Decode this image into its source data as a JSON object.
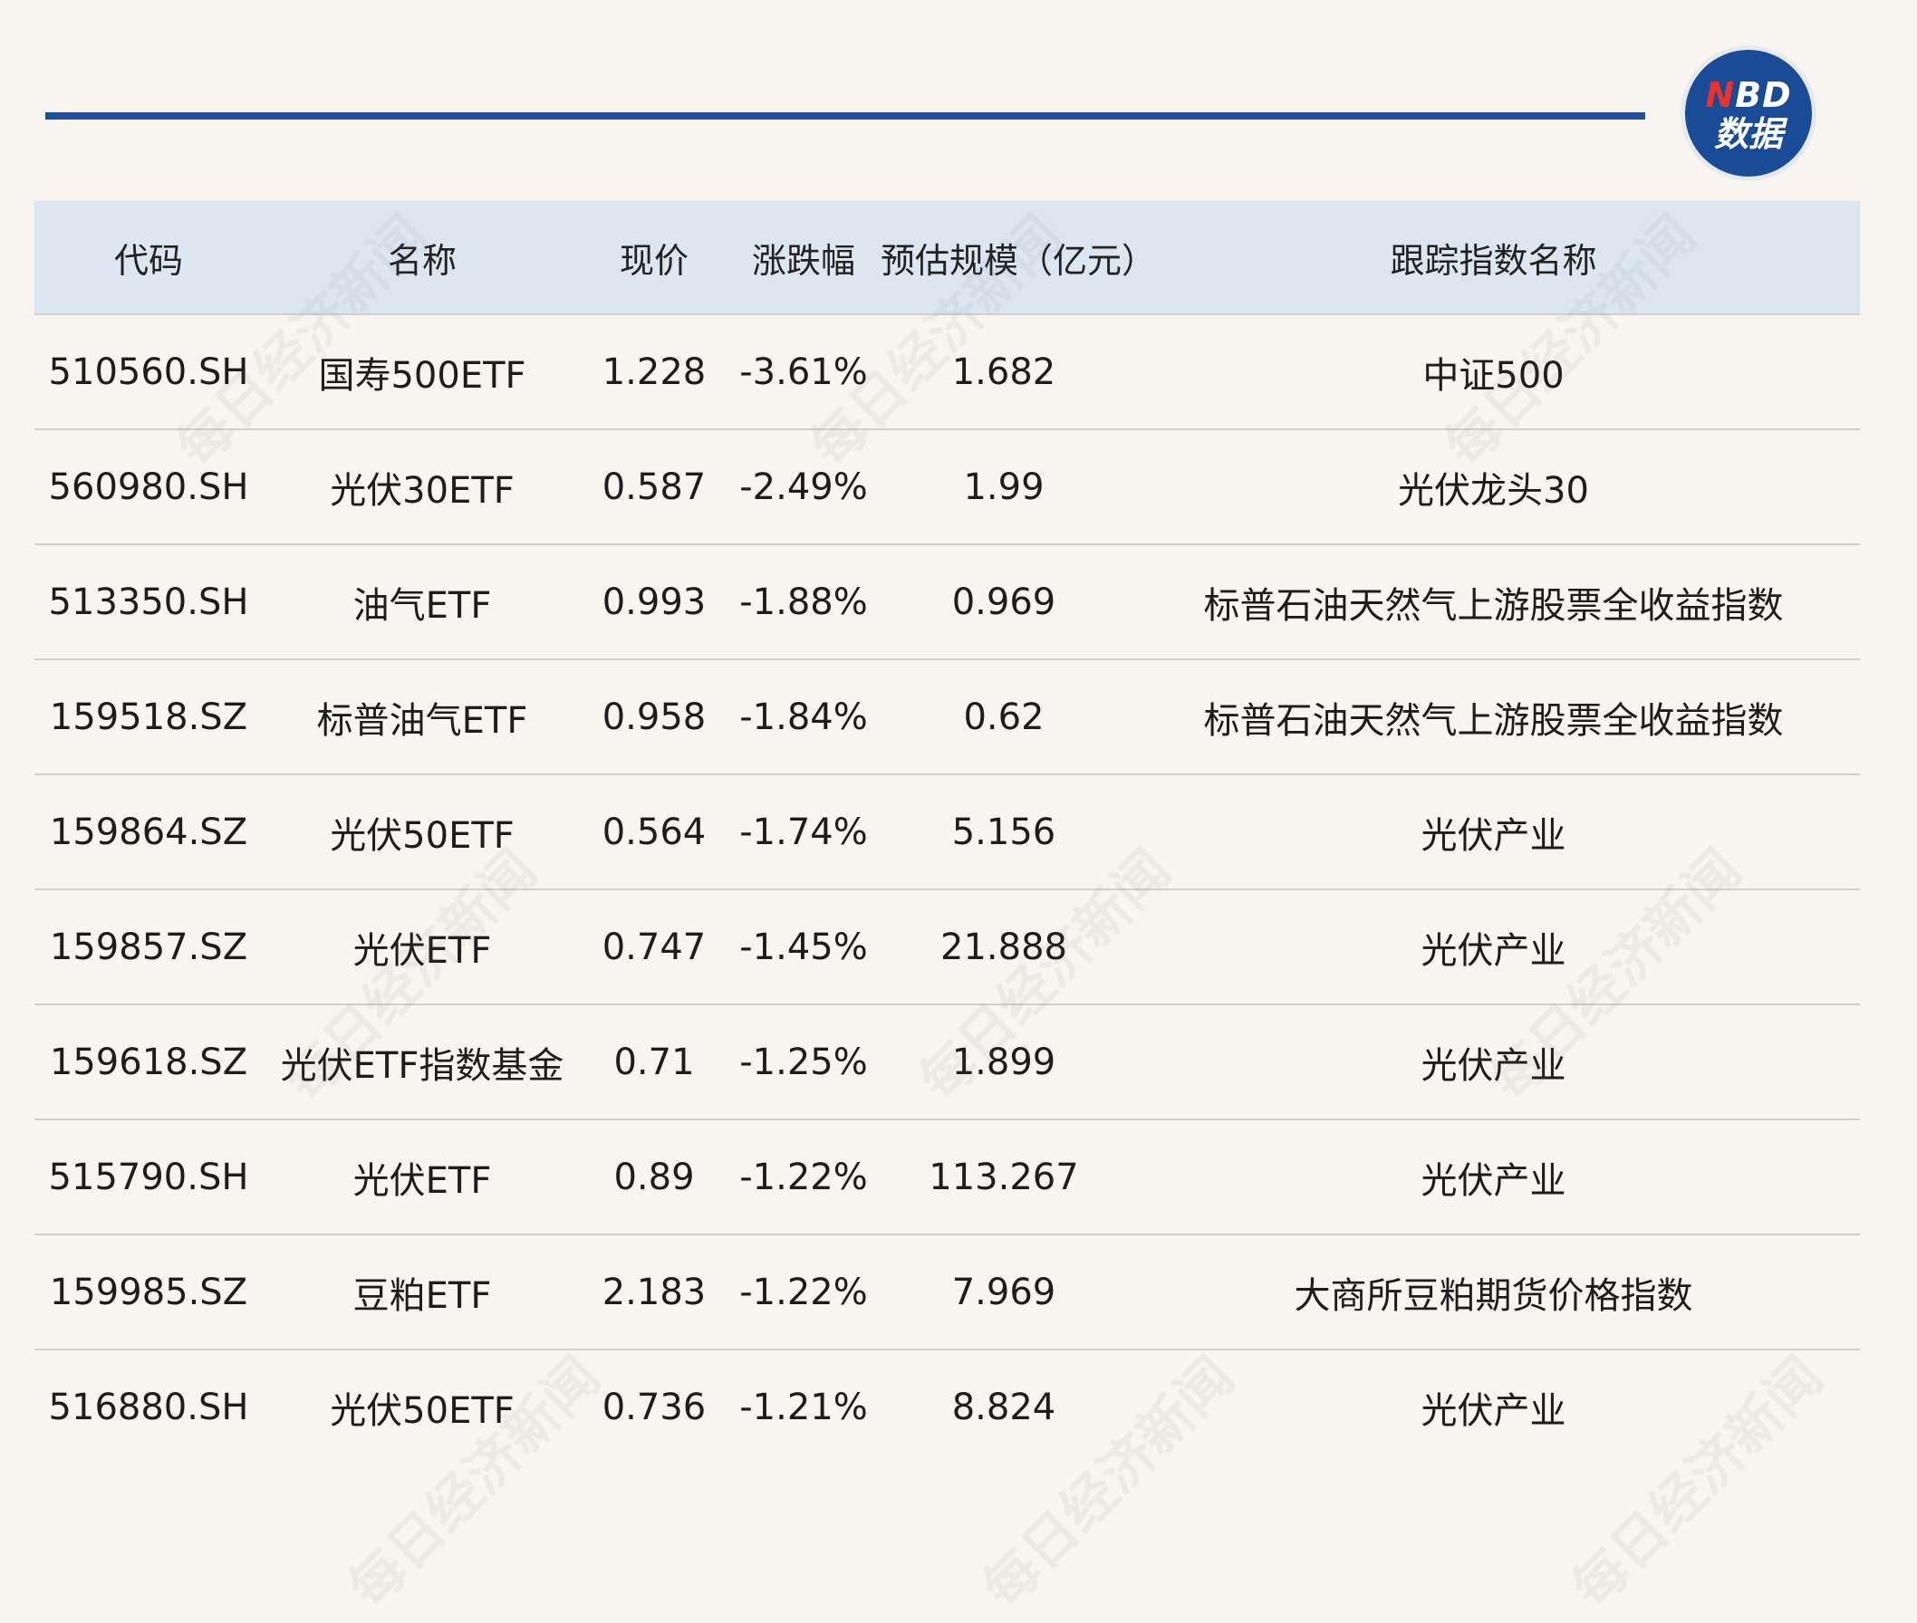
{
  "logo": {
    "line1_first": "N",
    "line1_rest": "BD",
    "line2": "数据"
  },
  "table": {
    "headers": [
      "代码",
      "名称",
      "现价",
      "涨跌幅",
      "预估规模（亿元）",
      "跟踪指数名称"
    ],
    "rows": [
      [
        "510560.SH",
        "国寿500ETF",
        "1.228",
        "-3.61%",
        "1.682",
        "中证500"
      ],
      [
        "560980.SH",
        "光伏30ETF",
        "0.587",
        "-2.49%",
        "1.99",
        "光伏龙头30"
      ],
      [
        "513350.SH",
        "油气ETF",
        "0.993",
        "-1.88%",
        "0.969",
        "标普石油天然气上游股票全收益指数"
      ],
      [
        "159518.SZ",
        "标普油气ETF",
        "0.958",
        "-1.84%",
        "0.62",
        "标普石油天然气上游股票全收益指数"
      ],
      [
        "159864.SZ",
        "光伏50ETF",
        "0.564",
        "-1.74%",
        "5.156",
        "光伏产业"
      ],
      [
        "159857.SZ",
        "光伏ETF",
        "0.747",
        "-1.45%",
        "21.888",
        "光伏产业"
      ],
      [
        "159618.SZ",
        "光伏ETF指数基金",
        "0.71",
        "-1.25%",
        "1.899",
        "光伏产业"
      ],
      [
        "515790.SH",
        "光伏ETF",
        "0.89",
        "-1.22%",
        "113.267",
        "光伏产业"
      ],
      [
        "159985.SZ",
        "豆粕ETF",
        "2.183",
        "-1.22%",
        "7.969",
        "大商所豆粕期货价格指数"
      ],
      [
        "516880.SH",
        "光伏50ETF",
        "0.736",
        "-1.21%",
        "8.824",
        "光伏产业"
      ]
    ]
  },
  "watermark": "每日经济新闻",
  "colors": {
    "rule": "#1f4f9c",
    "header_bg": "#dbe6f1",
    "logo_bg": "#1a4b96",
    "logo_accent": "#e8322b"
  }
}
